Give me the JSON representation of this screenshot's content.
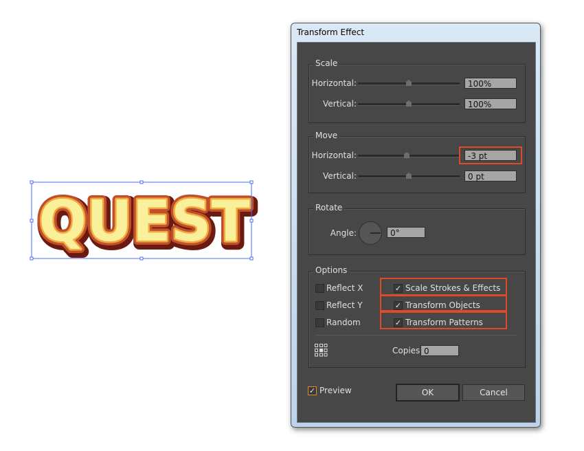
{
  "artwork": {
    "text": "QUEST"
  },
  "dialog": {
    "title": "Transform Effect",
    "scale": {
      "label": "Scale",
      "horizontal_label": "Horizontal:",
      "horizontal_value": "100%",
      "vertical_label": "Vertical:",
      "vertical_value": "100%"
    },
    "move": {
      "label": "Move",
      "horizontal_label": "Horizontal:",
      "horizontal_value": "-3 pt",
      "vertical_label": "Vertical:",
      "vertical_value": "0 pt"
    },
    "rotate": {
      "label": "Rotate",
      "angle_label": "Angle:",
      "angle_value": "0°"
    },
    "options": {
      "label": "Options",
      "reflect_x": "Reflect X",
      "reflect_y": "Reflect Y",
      "random": "Random",
      "scale_strokes": "Scale Strokes & Effects",
      "transform_objects": "Transform Objects",
      "transform_patterns": "Transform Patterns",
      "copies_label": "Copies",
      "copies_value": "0"
    },
    "preview_label": "Preview",
    "ok_label": "OK",
    "cancel_label": "Cancel",
    "highlight_color": "#e04a2a"
  }
}
